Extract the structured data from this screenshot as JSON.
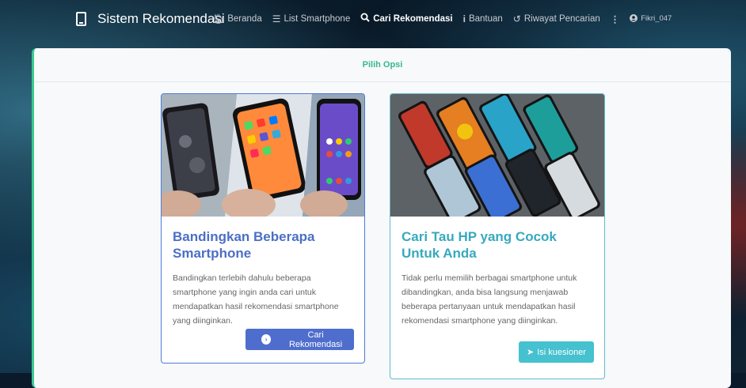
{
  "navbar": {
    "brand": "Sistem Rekomendasi",
    "items": [
      {
        "label": "Beranda",
        "icon": "home-icon",
        "active": false
      },
      {
        "label": "List Smartphone",
        "icon": "list-icon",
        "active": false
      },
      {
        "label": "Cari Rekomendasi",
        "icon": "search-icon",
        "active": true
      },
      {
        "label": "Bantuan",
        "icon": "info-icon",
        "active": false
      },
      {
        "label": "Riwayat Pencarian",
        "icon": "history-icon",
        "active": false
      }
    ],
    "user": "Fikri_047"
  },
  "panel": {
    "header": "Pilih Opsi"
  },
  "cards": {
    "compare": {
      "title": "Bandingkan Beberapa Smartphone",
      "text": "Bandingkan terlebih dahulu beberapa smartphone yang ingin anda cari untuk mendapatkan hasil rekomendasi smartphone yang diinginkan.",
      "button": "Cari Rekomendasi"
    },
    "quiz": {
      "title": "Cari Tau HP yang Cocok Untuk Anda",
      "text": "Tidak perlu memilih berbagai smartphone untuk dibandingkan, anda bisa langsung menjawab beberapa pertanyaan untuk mendapatkan hasil rekomendasi smartphone yang diinginkan.",
      "button": "Isi kuesioner"
    }
  },
  "colors": {
    "accent_green": "#36b98a",
    "card_blue": "#4f6dcd",
    "card_teal": "#45c1cf"
  }
}
